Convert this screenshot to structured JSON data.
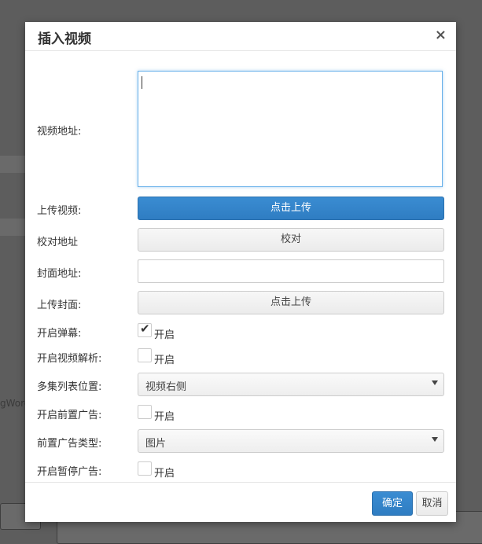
{
  "background": {
    "partial_text": "gWord"
  },
  "dialog": {
    "title": "插入视频",
    "close_symbol": "×",
    "fields": {
      "video_url_label": "视频地址:",
      "upload_video_label": "上传视频:",
      "upload_video_button": "点击上传",
      "proofread_label": "校对地址",
      "proofread_button": "校对",
      "cover_url_label": "封面地址:",
      "upload_cover_label": "上传封面:",
      "upload_cover_button": "点击上传",
      "danmaku_label": "开启弹幕:",
      "danmaku_option": "开启",
      "parse_label": "开启视频解析:",
      "parse_option": "开启",
      "playlist_pos_label": "多集列表位置:",
      "playlist_pos_value": "视频右侧",
      "preroll_label": "开启前置广告:",
      "preroll_option": "开启",
      "preroll_type_label": "前置广告类型:",
      "preroll_type_value": "图片",
      "pause_ad_label": "开启暂停广告:",
      "pause_ad_option": "开启"
    },
    "state": {
      "danmaku_checked": true,
      "parse_checked": false,
      "preroll_checked": false,
      "pause_ad_checked": false
    },
    "footer": {
      "ok": "确定",
      "cancel": "取消"
    }
  },
  "colors": {
    "primary": "#3485cf",
    "overlay": "#5d5d5d"
  }
}
